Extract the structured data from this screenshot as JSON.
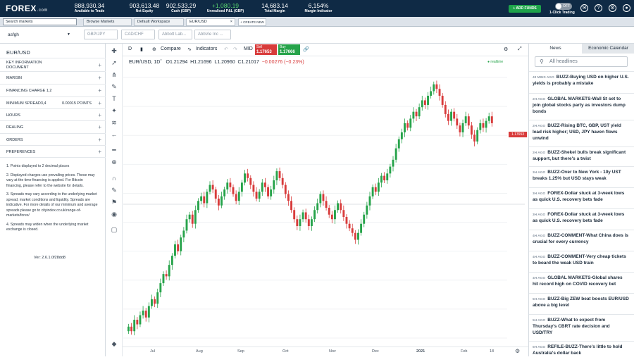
{
  "brand": {
    "name": "FOREX",
    "suffix": ".com"
  },
  "stats": [
    {
      "value": "888,930.34",
      "label": "Available to Trade"
    },
    {
      "value": "903,613.48",
      "label": "Net Equity"
    },
    {
      "value": "902,533.29",
      "label": "Cash (GBP)"
    },
    {
      "value": "+1,080.19",
      "label": "Unrealised P&L (GBP)"
    },
    {
      "value": "14,683.14",
      "label": "Total Margin"
    },
    {
      "value": "6,154%",
      "label": "Margin Indicator"
    }
  ],
  "topbar": {
    "add_funds": "+ ADD FUNDS",
    "toggle": "OFF",
    "one_click": "1-Click Trading"
  },
  "tabs": {
    "search": "Search markets",
    "items": [
      "Browse Markets",
      "Default Workspace",
      "EUR/USD"
    ],
    "create": "+ CREATE NEW"
  },
  "account": "asfgh",
  "chips": [
    "GBP/JPY",
    "CAD/CHF",
    "Abbott Lab...",
    "AbbVie Inc ..."
  ],
  "left": {
    "title": "EUR/USD",
    "rows": [
      {
        "label": "KEY INFORMATION DOCUMENT"
      },
      {
        "label": "MARGIN"
      },
      {
        "label": "FINANCING CHARGE 1,2"
      },
      {
        "label": "MINIMUM SPREAD3,4",
        "value": "0.00015 POINTS"
      },
      {
        "label": "HOURS"
      },
      {
        "label": "DEALING"
      },
      {
        "label": "ORDERS"
      },
      {
        "label": "PREFERENCES"
      }
    ],
    "notes": [
      "1. Points displayed to 2 decimal places",
      "2. Displayed charges use prevailing prices. These may vary at the time financing is applied. For Bitcoin financing, please refer to the website for details.",
      "3. Spreads may vary according to the underlying market spread, market conditions and liquidity. Spreads are indicative. For more details of our minimum and average spreads please go to cityindex.co.uk/range-of-markets/forex/",
      "4. Spreads may widen when the underlying market exchange is closed."
    ],
    "version": "Ver: 2.6.1.0f28dd8"
  },
  "chart_header": {
    "interval": "D",
    "compare": "Compare",
    "indicators": "Indicators",
    "mid": "MID",
    "sell_label": "Sell",
    "sell_price": "1.17653",
    "buy_label": "Buy",
    "buy_price": "1.17666"
  },
  "ohlc": {
    "symbol": "EUR/USD, 1D",
    "o": "O1.21294",
    "h": "H1.21696",
    "l": "L1.20960",
    "c": "C1.21017",
    "chg": "−0.00276 (−0.23%)"
  },
  "realtime": "● realtime",
  "last_price": "1.17653",
  "x_labels": [
    "Jul",
    "Aug",
    "Sep",
    "Oct",
    "Nov",
    "Dec",
    "2021",
    "Feb",
    "18"
  ],
  "colors": {
    "up": "#26a34a",
    "down": "#d83b3b",
    "header": "#0f2a45"
  },
  "chart_data": {
    "type": "candlestick",
    "symbol": "EUR/USD",
    "interval": "1D",
    "x_ticks": [
      "Jul",
      "Aug",
      "Sep",
      "Oct",
      "Nov",
      "Dec",
      "2021",
      "Feb",
      "18"
    ],
    "last_price": 1.17653,
    "close": [
      1.123,
      1.121,
      1.126,
      1.124,
      1.128,
      1.13,
      1.127,
      1.132,
      1.135,
      1.133,
      1.138,
      1.142,
      1.146,
      1.145,
      1.15,
      1.154,
      1.159,
      1.156,
      1.162,
      1.165,
      1.17,
      1.172,
      1.168,
      1.174,
      1.178,
      1.18,
      1.177,
      1.182,
      1.185,
      1.183,
      1.179,
      1.176,
      1.18,
      1.183,
      1.186,
      1.184,
      1.181,
      1.178,
      1.182,
      1.186,
      1.19,
      1.188,
      1.185,
      1.182,
      1.179,
      1.182,
      1.186,
      1.184,
      1.18,
      1.183,
      1.187,
      1.191,
      1.188,
      1.185,
      1.181,
      1.178,
      1.174,
      1.17,
      1.167,
      1.17,
      1.173,
      1.17,
      1.167,
      1.17,
      1.174,
      1.177,
      1.181,
      1.178,
      1.175,
      1.172,
      1.17,
      1.174,
      1.177,
      1.174,
      1.171,
      1.168,
      1.166,
      1.164,
      1.161,
      1.164,
      1.168,
      1.172,
      1.176,
      1.18,
      1.184,
      1.182,
      1.186,
      1.189,
      1.187,
      1.19,
      1.193,
      1.196,
      1.201,
      1.205,
      1.208,
      1.212,
      1.21,
      1.214,
      1.217,
      1.215,
      1.219,
      1.222,
      1.22,
      1.224,
      1.226,
      1.229,
      1.227,
      1.224,
      1.22,
      1.216,
      1.213,
      1.217,
      1.214,
      1.211,
      1.208,
      1.212,
      1.215,
      1.211,
      1.207,
      1.204,
      1.209,
      1.212,
      1.21,
      1.213,
      1.215,
      1.212
    ]
  },
  "right": {
    "tabs": [
      "News",
      "Economic Calendar"
    ],
    "search_placeholder": "All headlines",
    "news": [
      {
        "ago": "43 MINS AGO",
        "title": "BUZZ-Buying USD on higher U.S. yields is probably a mistake"
      },
      {
        "ago": "2H AGO",
        "title": "GLOBAL MARKETS-Wall St set to join global stocks party as investors dump bonds"
      },
      {
        "ago": "2H AGO",
        "title": "BUZZ-Rising BTC, GBP, UST yield lead risk higher; USD, JPY haven flows unwind"
      },
      {
        "ago": "2H AGO",
        "title": "BUZZ-Shekel bulls break significant support, but there's a twist"
      },
      {
        "ago": "3H AGO",
        "title": "BUZZ-Over to New York - 10y UST breaks 1.25% but USD stays weak"
      },
      {
        "ago": "3H AGO",
        "title": "FOREX-Dollar stuck at 3-week lows as quick U.S. recovery bets fade"
      },
      {
        "ago": "3H AGO",
        "title": "FOREX-Dollar stuck at 3-week lows as quick U.S. recovery bets fade"
      },
      {
        "ago": "4H AGO",
        "title": "BUZZ-COMMENT-What China does is crucial for every currency"
      },
      {
        "ago": "4H AGO",
        "title": "BUZZ-COMMENT-Very cheap tickets to board the weak USD train"
      },
      {
        "ago": "4H AGO",
        "title": "GLOBAL MARKETS-Global shares hit record high on COVID recovery bet"
      },
      {
        "ago": "5H AGO",
        "title": "BUZZ-Big ZEW beat boosts EUR/USD above a big level"
      },
      {
        "ago": "5H AGO",
        "title": "BUZZ-What to expect from Thursday's CBRT rate decision and USD/TRY"
      },
      {
        "ago": "5H AGO",
        "title": "REFILE-BUZZ-There's little to hold Australia's dollar back"
      }
    ]
  }
}
